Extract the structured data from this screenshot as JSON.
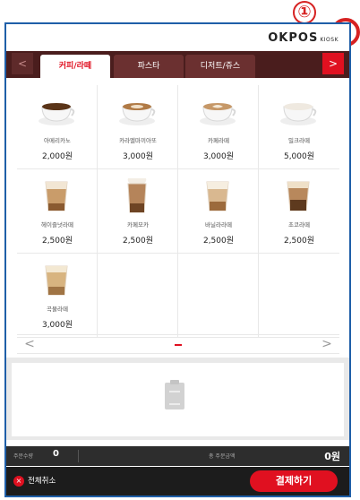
{
  "annotation": {
    "number": "①"
  },
  "header": {
    "logo": "OKPOS",
    "logo_sub": "KIOSK"
  },
  "tabs": [
    {
      "label": "커피/라떼",
      "active": true
    },
    {
      "label": "파스타",
      "active": false
    },
    {
      "label": "디저트/쥬스",
      "active": false
    }
  ],
  "tab_nav": {
    "prev": "<",
    "next": ">"
  },
  "products": [
    {
      "name": "아메리카노",
      "price": "2,000원",
      "icon": "americano-cup-image"
    },
    {
      "name": "카라멜마끼아또",
      "price": "3,000원",
      "icon": "caramel-macchiato-image"
    },
    {
      "name": "카페라떼",
      "price": "3,000원",
      "icon": "cafe-latte-image"
    },
    {
      "name": "밀크라떼",
      "price": "5,000원",
      "icon": "milk-latte-image"
    },
    {
      "name": "헤이즐넛라떼",
      "price": "2,500원",
      "icon": "hazelnut-latte-image"
    },
    {
      "name": "카페모카",
      "price": "2,500원",
      "icon": "cafe-mocha-image"
    },
    {
      "name": "바닐라라떼",
      "price": "2,500원",
      "icon": "vanilla-latte-image"
    },
    {
      "name": "초코라떼",
      "price": "2,500원",
      "icon": "choco-latte-image"
    },
    {
      "name": "곡물라떼",
      "price": "3,000원",
      "icon": "grain-latte-image"
    }
  ],
  "pager": {
    "prev": "<",
    "next": ">"
  },
  "summary": {
    "qty_label": "주문수량",
    "qty": "0",
    "amount_label": "총 주문금액",
    "amount": "0원"
  },
  "actions": {
    "cancel_all": "전체취소",
    "cancel_icon": "×",
    "pay": "결제하기"
  },
  "colors": {
    "accent": "#e01020",
    "tabbar": "#4a1d1d",
    "frame": "#1f5fa8"
  }
}
